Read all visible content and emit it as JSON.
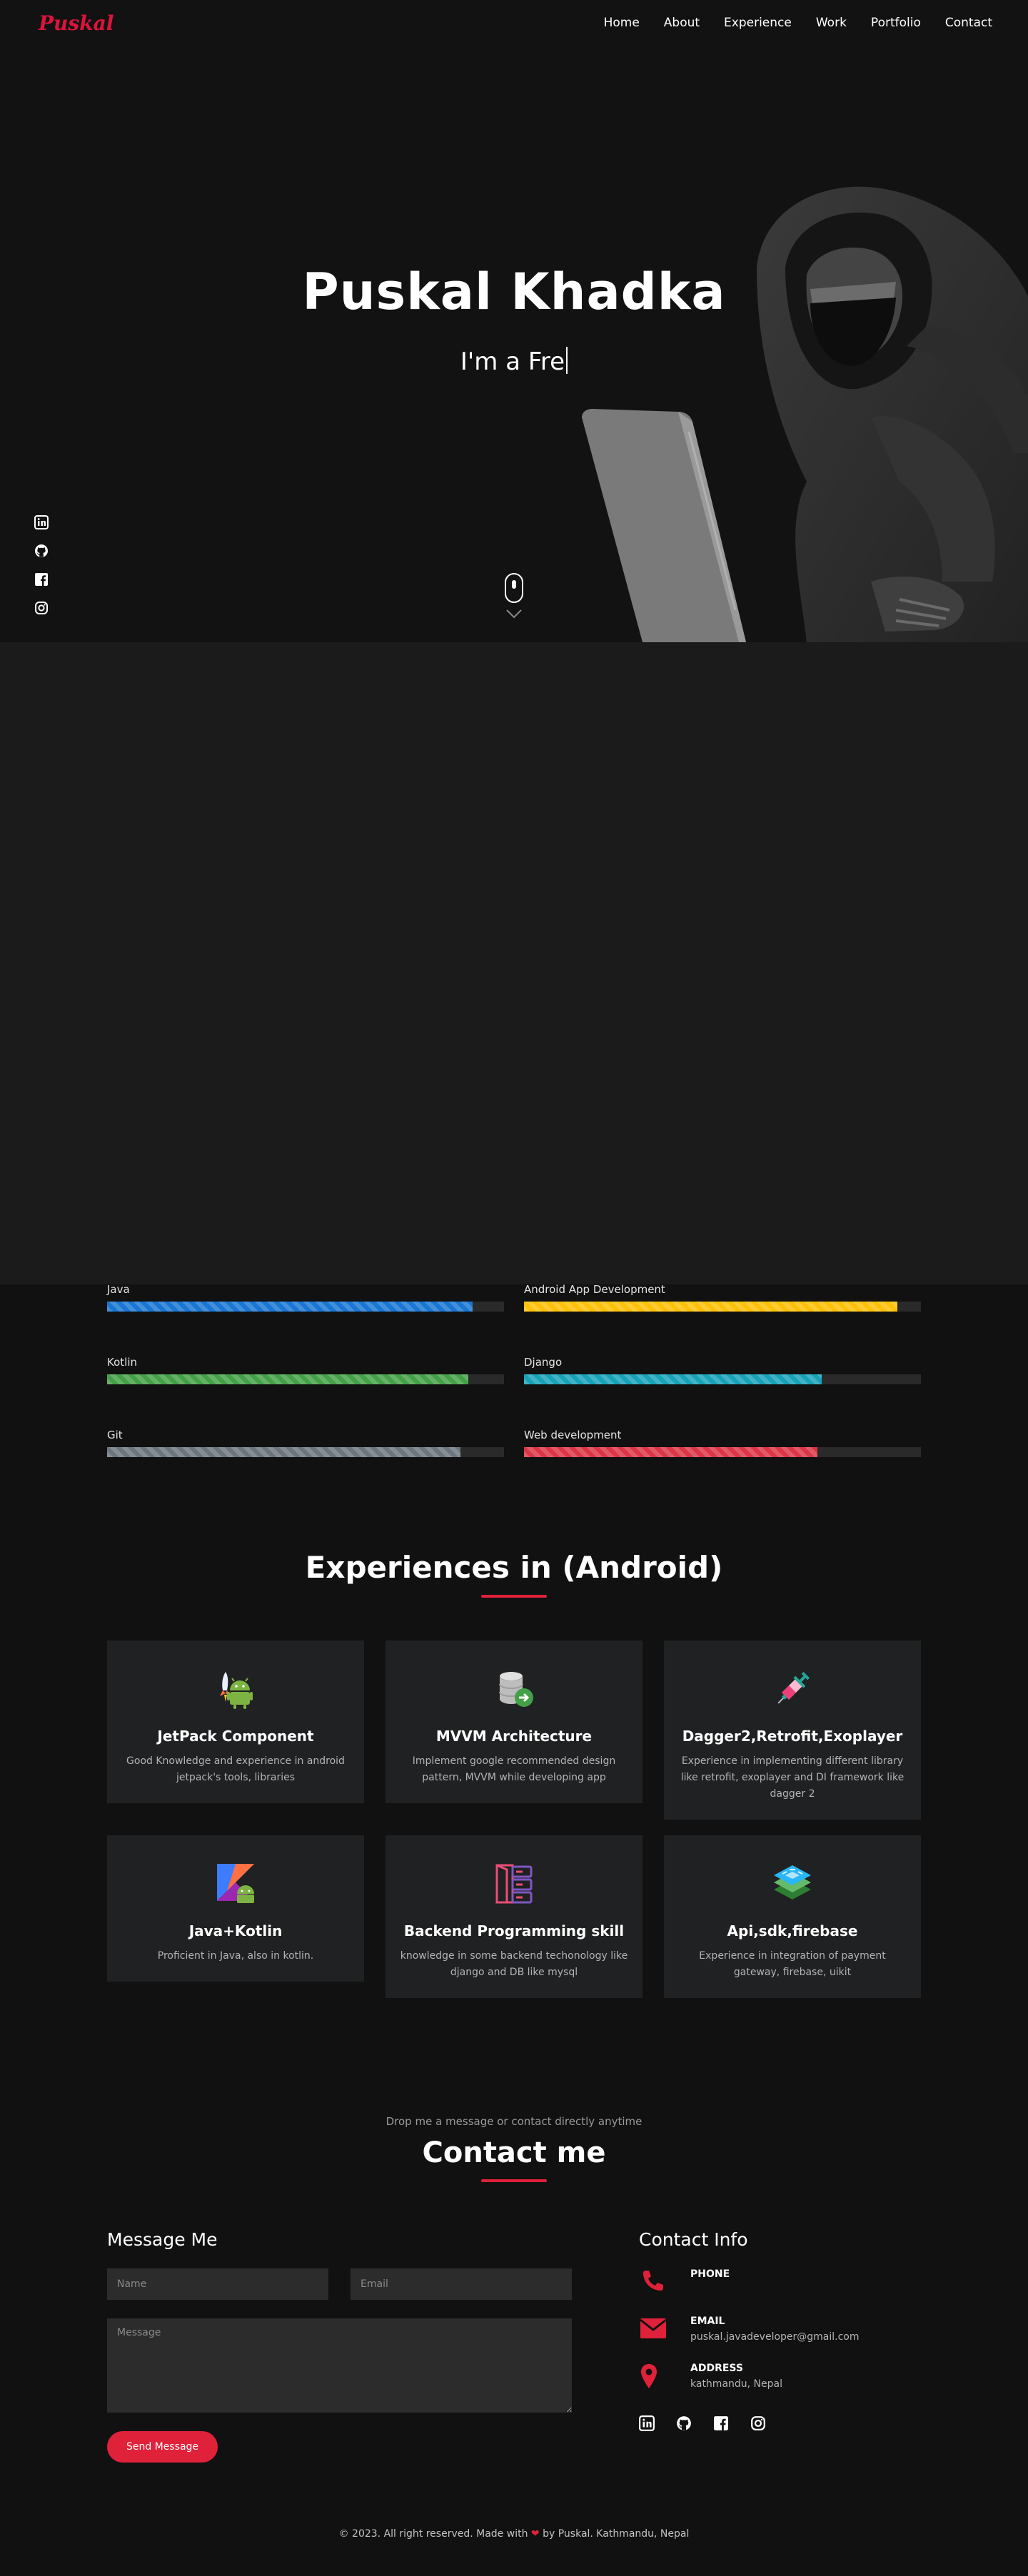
{
  "nav": {
    "logo": "Puskal",
    "items": [
      "Home",
      "About",
      "Experience",
      "Work",
      "Portfolio",
      "Contact"
    ]
  },
  "hero": {
    "name": "Puskal Khadka",
    "typed_text": "I'm a Fre"
  },
  "social_icons": [
    "linkedin-icon",
    "github-icon",
    "facebook-icon",
    "instagram-icon"
  ],
  "skills": [
    {
      "label": "Java",
      "percent": 92,
      "color": "#1976d2"
    },
    {
      "label": "Android App Development",
      "percent": 94,
      "color": "#ffc107"
    },
    {
      "label": "Kotlin",
      "percent": 91,
      "color": "#43a047"
    },
    {
      "label": "Django",
      "percent": 75,
      "color": "#17a2b8"
    },
    {
      "label": "Git",
      "percent": 89,
      "color": "#6c757d"
    },
    {
      "label": "Web development",
      "percent": 74,
      "color": "#dc3545"
    }
  ],
  "experience": {
    "title": "Experiences in (Android)",
    "cards": [
      {
        "icon": "android-rocket-icon",
        "title": "JetPack Component",
        "desc": "Good Knowledge and experience in android jetpack's tools, libraries"
      },
      {
        "icon": "database-arrow-icon",
        "title": "MVVM Architecture",
        "desc": "Implement google recommended design pattern, MVVM while developing app"
      },
      {
        "icon": "syringe-icon",
        "title": "Dagger2,Retrofit,Exoplayer",
        "desc": "Experience in implementing different library like retrofit, exoplayer and DI framework like dagger 2"
      },
      {
        "icon": "kotlin-android-icon",
        "title": "Java+Kotlin",
        "desc": "Proficient in Java, also in kotlin."
      },
      {
        "icon": "server-icon",
        "title": "Backend Programming skill",
        "desc": "knowledge in some backend techonology like django and DB like mysql"
      },
      {
        "icon": "api-stack-icon",
        "title": "Api,sdk,firebase",
        "desc": "Experience in integration of payment gateway, firebase, uikit"
      }
    ]
  },
  "contact": {
    "subtitle": "Drop me a message or contact directly anytime",
    "title": "Contact me",
    "form_title": "Message Me",
    "name_placeholder": "Name",
    "email_placeholder": "Email",
    "message_placeholder": "Message",
    "send_label": "Send Message",
    "info_title": "Contact Info",
    "info": [
      {
        "icon": "phone-icon",
        "label": "PHONE",
        "value": ""
      },
      {
        "icon": "envelope-icon",
        "label": "EMAIL",
        "value": "puskal.javadeveloper@gmail.com"
      },
      {
        "icon": "map-pin-icon",
        "label": "ADDRESS",
        "value": "kathmandu, Nepal"
      }
    ]
  },
  "footer": {
    "before": "© 2023. All right reserved. Made with",
    "after": "by Puskal. Kathmandu, Nepal"
  },
  "colors": {
    "accent": "#e0213a",
    "background": "#111111",
    "card": "#202122"
  }
}
